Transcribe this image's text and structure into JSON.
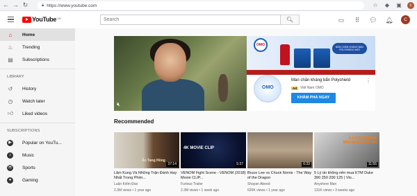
{
  "browser": {
    "url": "https://www.youtube.com",
    "profile_initial": "c"
  },
  "header": {
    "logo_text": "YouTube",
    "logo_country": "VN",
    "search_placeholder": "Search",
    "avatar_initial": "C"
  },
  "sidebar": {
    "main_items": [
      {
        "label": "Home",
        "icon": "home-icon",
        "active": true
      },
      {
        "label": "Trending",
        "icon": "trending-icon"
      },
      {
        "label": "Subscriptions",
        "icon": "subscriptions-icon"
      }
    ],
    "library_heading": "LIBRARY",
    "library_items": [
      {
        "label": "History",
        "icon": "history-icon"
      },
      {
        "label": "Watch later",
        "icon": "clock-icon"
      },
      {
        "label": "Liked videos",
        "icon": "thumbs-up-icon"
      }
    ],
    "subscriptions_heading": "SUBSCRIPTIONS",
    "subscription_items": [
      {
        "label": "Popular on YouTu..."
      },
      {
        "label": "Music"
      },
      {
        "label": "Sports"
      },
      {
        "label": "Gaming"
      }
    ]
  },
  "ad": {
    "banner_tag": "BẢN CHĂN KHÁNG BẨN POLYSHIELD MỚI",
    "brand_logo": "OMO",
    "title": "Màn chăn kháng bẩn Polyshield",
    "badge": "Ad",
    "sponsor": "Việt Nam OMO",
    "cta": "KHÁM PHÁ NGAY"
  },
  "recommended": {
    "heading": "Recommended",
    "videos": [
      {
        "title": "Lâm Kung Và Những Trận Đánh Hay Nhất Trong Phim...",
        "channel": "Luận Kiếm Đao",
        "meta": "2.3M views • 1 year ago",
        "duration": "37:14",
        "thumb_text": "Ấn Tang Hồng"
      },
      {
        "title": "VENOM Fight Scene - VENOM (2018) Movie CLIP...",
        "channel": "Furious Trailer",
        "meta": "2.3M views • 1 week ago",
        "duration": "5:37",
        "thumb_text": "4K MOVIE CLIP"
      },
      {
        "title": "Bruce Lee vs Chuck Norris - The Way of the Dragon",
        "channel": "Shayan Abeed",
        "meta": "626K views • 1 year ago",
        "duration": "6:33",
        "thumb_text": ""
      },
      {
        "title": "5 Lý do không nên mua KTM Duke 390 250 200 125 | Vlo...",
        "channel": "Anyshere Man",
        "meta": "131K views • 3 weeks ago",
        "duration": "11:55",
        "thumb_text": "5 LÝ DO KHÔNG NÊN MUA DUKE 390"
      }
    ]
  }
}
